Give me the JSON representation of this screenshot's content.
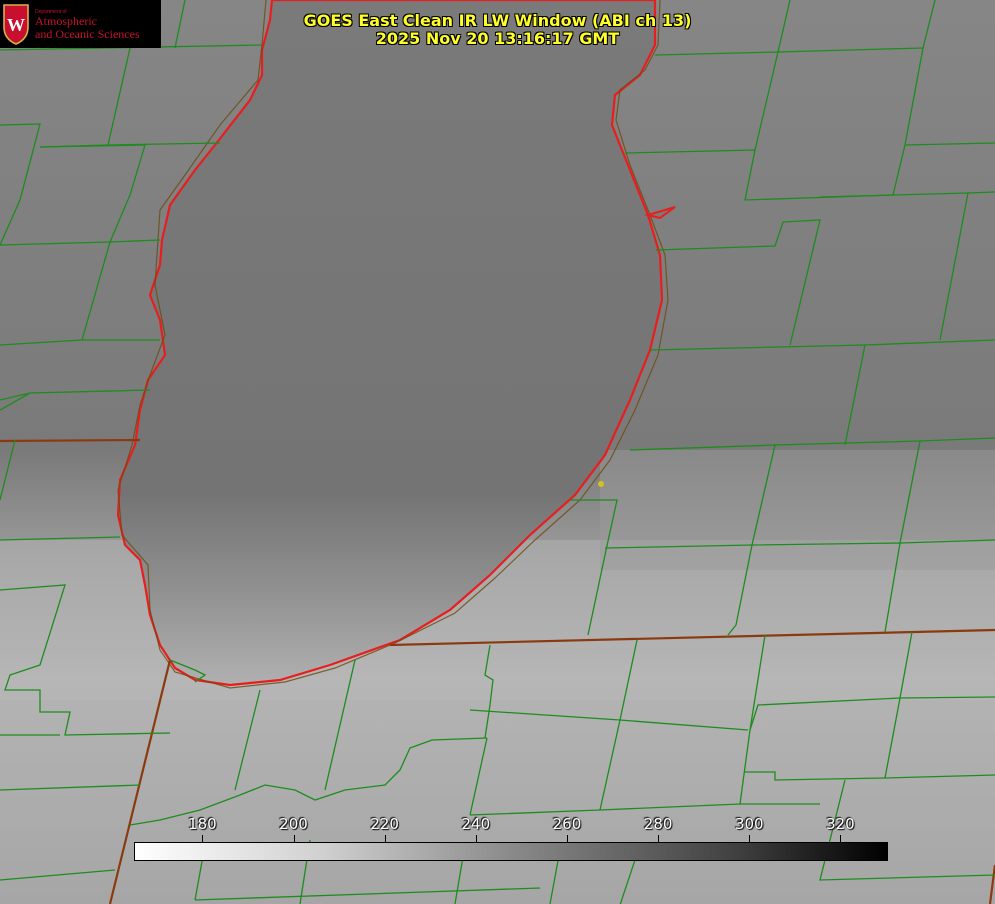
{
  "title": {
    "line1": "GOES East Clean IR LW Window (ABI ch 13)",
    "line2": "2025 Nov 20 13:16:17 GMT"
  },
  "logo": {
    "small": "Department of",
    "line1": "Atmospheric",
    "line2": "and Oceanic Sciences",
    "seal_letter": "W"
  },
  "colorbar": {
    "ticks": [
      "180",
      "200",
      "220",
      "240",
      "260",
      "280",
      "300",
      "320"
    ],
    "range": [
      165,
      330
    ]
  },
  "colors": {
    "coastline": "#e81e1e",
    "county_lines": "#1e8c1e",
    "state_lines": "#8b3a0f",
    "title": "#ffff2a",
    "logo_accent": "#c8102e"
  }
}
